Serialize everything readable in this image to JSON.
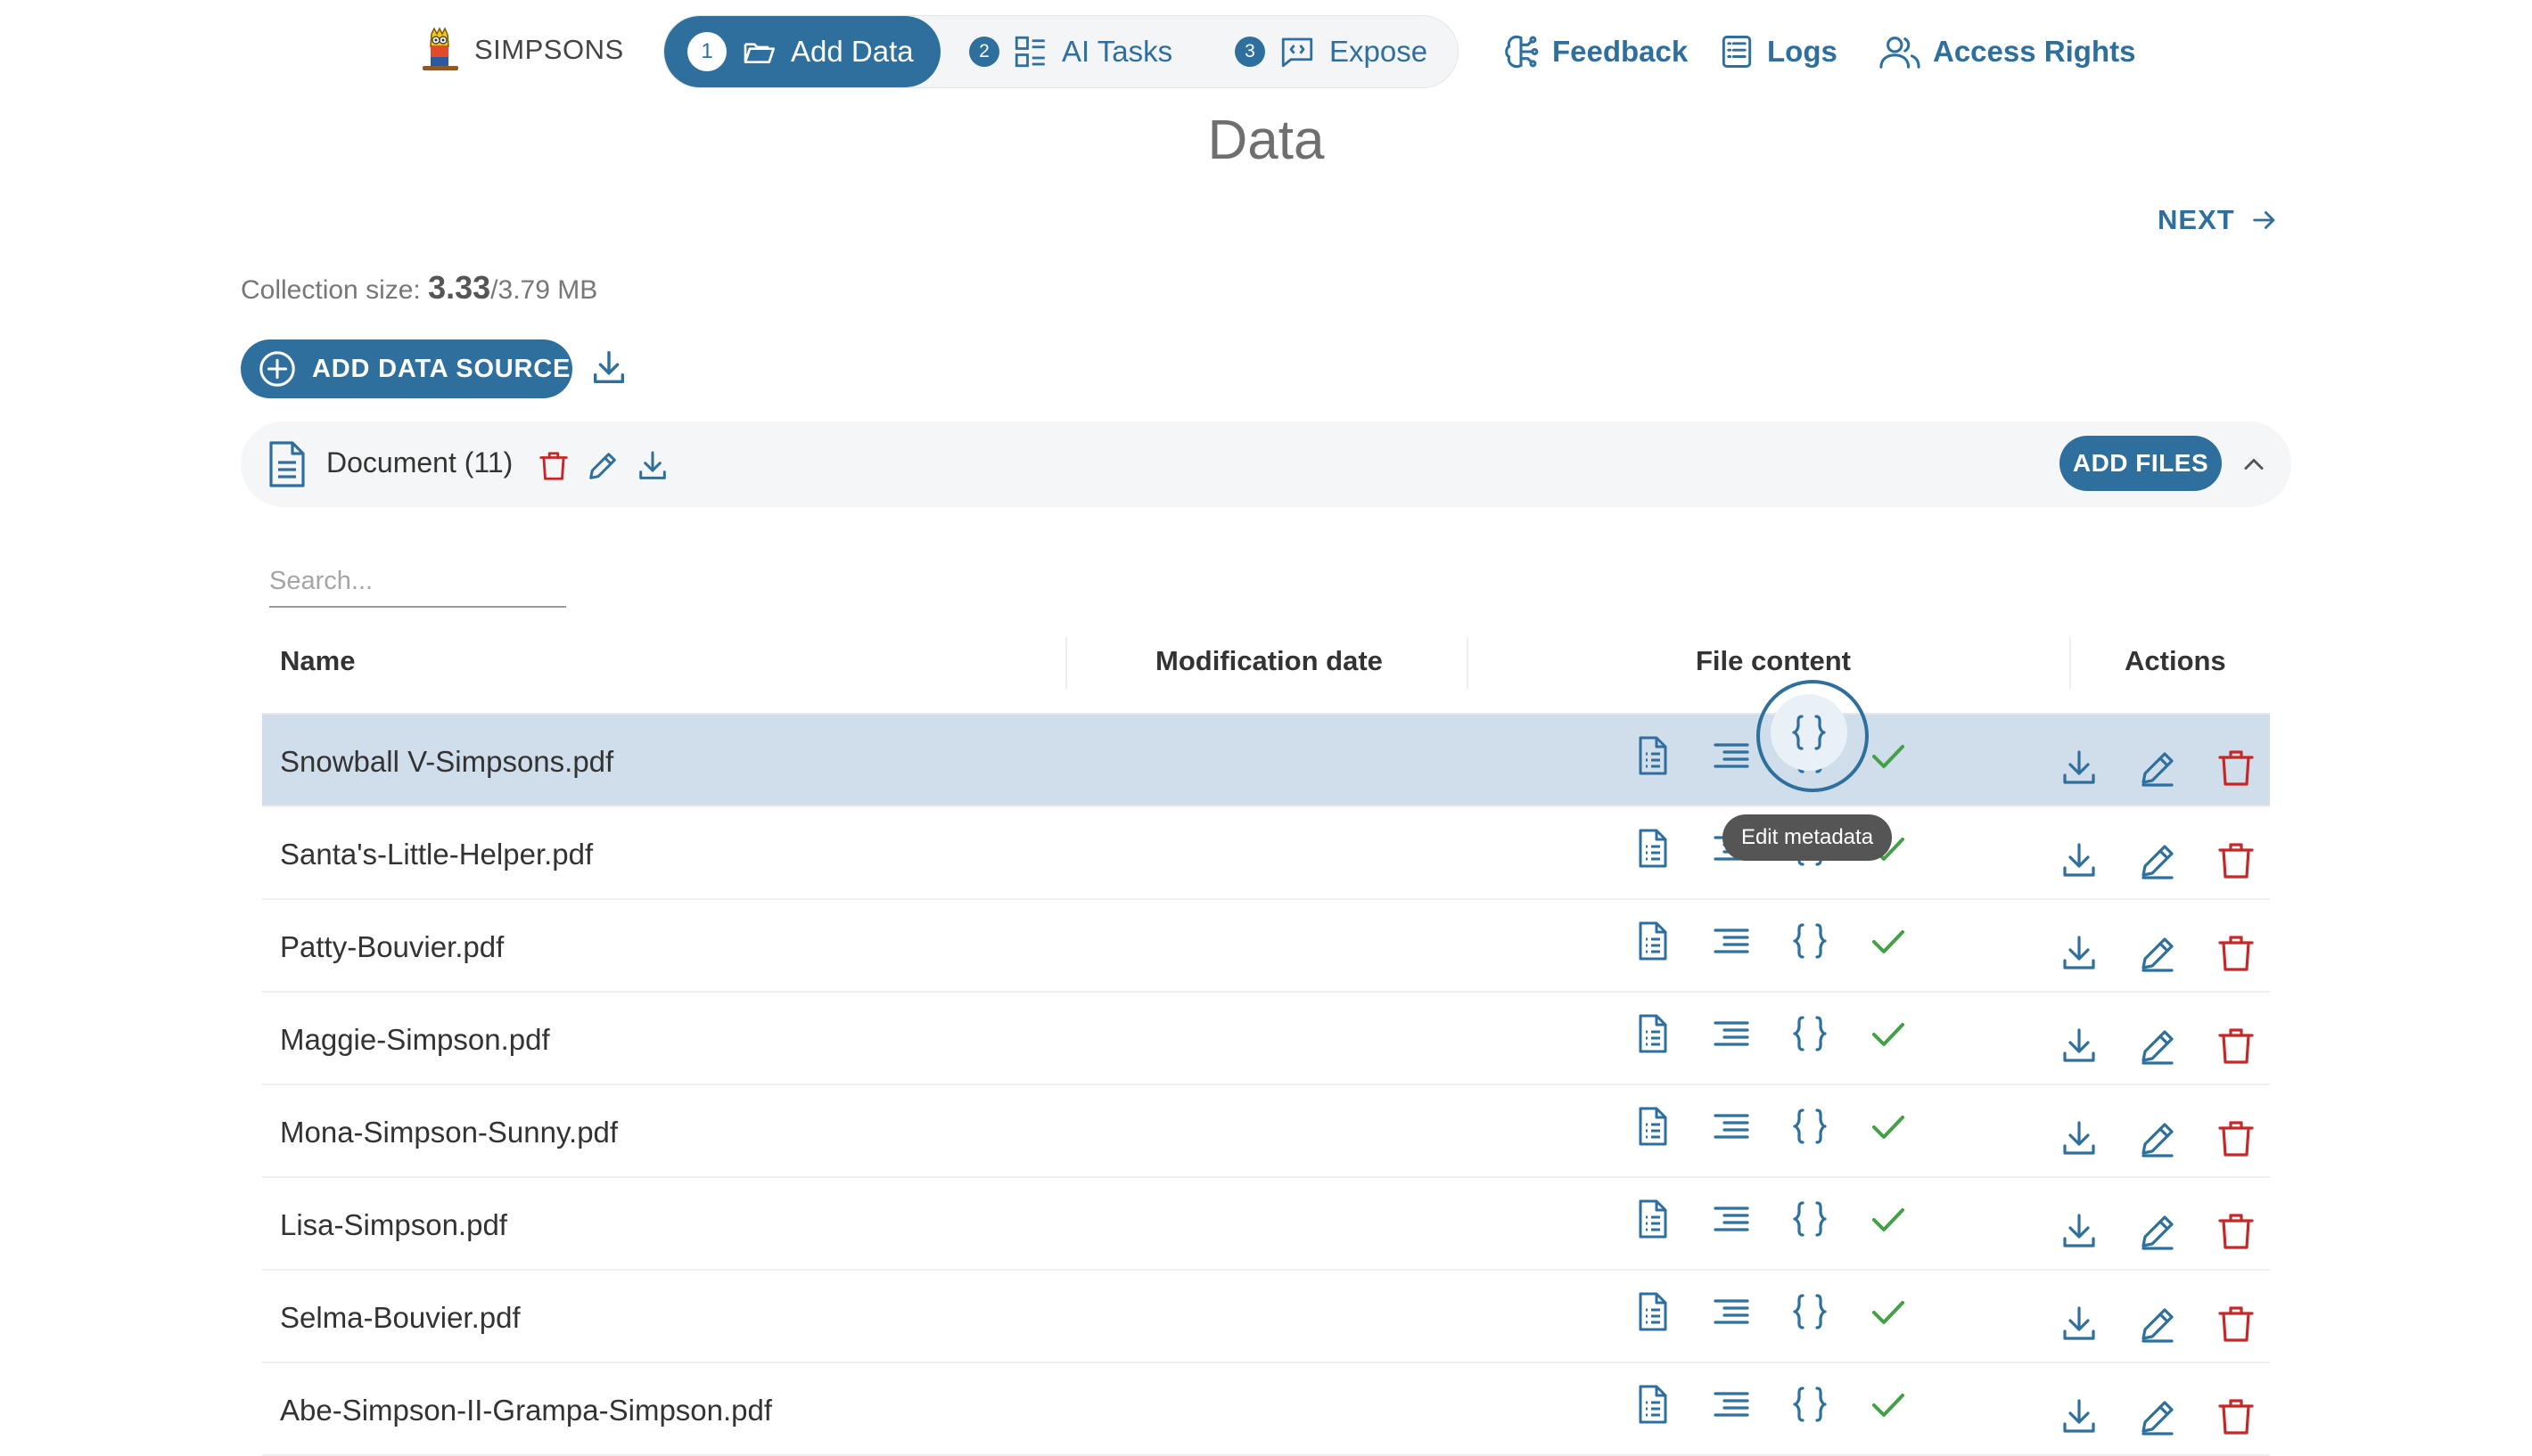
{
  "app": {
    "brand": "SIMPSONS"
  },
  "steps": [
    {
      "num": "1",
      "label": "Add Data"
    },
    {
      "num": "2",
      "label": "AI Tasks"
    },
    {
      "num": "3",
      "label": "Expose"
    }
  ],
  "nav": {
    "feedback": "Feedback",
    "logs": "Logs",
    "access": "Access Rights"
  },
  "page": {
    "title": "Data",
    "next": "NEXT"
  },
  "collection": {
    "label": "Collection size: ",
    "used": "3.33",
    "total": "/3.79 MB"
  },
  "add_source": "ADD DATA SOURCE",
  "document_group": {
    "label": "Document (11)",
    "add_files": "ADD FILES"
  },
  "search": {
    "placeholder": "Search...",
    "value": ""
  },
  "table": {
    "headers": {
      "name": "Name",
      "modified": "Modification date",
      "content": "File content",
      "actions": "Actions"
    },
    "rows": [
      {
        "name": "Snowball V-Simpsons.pdf",
        "modified": ""
      },
      {
        "name": "Santa's-Little-Helper.pdf",
        "modified": ""
      },
      {
        "name": "Patty-Bouvier.pdf",
        "modified": ""
      },
      {
        "name": "Maggie-Simpson.pdf",
        "modified": ""
      },
      {
        "name": "Mona-Simpson-Sunny.pdf",
        "modified": ""
      },
      {
        "name": "Lisa-Simpson.pdf",
        "modified": ""
      },
      {
        "name": "Selma-Bouvier.pdf",
        "modified": ""
      },
      {
        "name": "Abe-Simpson-II-Grampa-Simpson.pdf",
        "modified": ""
      }
    ]
  },
  "tooltip": "Edit metadata",
  "colors": {
    "primary": "#2e6f9e",
    "delete": "#c62828",
    "success": "#43a047",
    "selected_row": "#cfdeea"
  }
}
